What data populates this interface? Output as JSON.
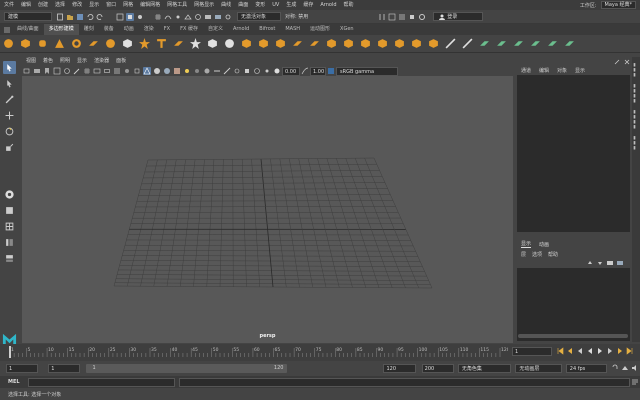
{
  "menubar": {
    "items": [
      "文件",
      "编辑",
      "创建",
      "选择",
      "修改",
      "显示",
      "窗口",
      "网格",
      "编辑网格",
      "网格工具",
      "网格显示",
      "曲线",
      "曲面",
      "变形",
      "UV",
      "生成",
      "缓存",
      "Arnold",
      "帮助"
    ],
    "workspace_label": "工作区:",
    "workspace_value": "Maya 经典*"
  },
  "statusline": {
    "menuset": "建模",
    "name_field_placeholder": "无激活对象",
    "symmetry_label": "对称: 禁用",
    "login": "登录"
  },
  "shelf": {
    "tabs": [
      "曲线/曲面",
      "多边形建模",
      "雕刻",
      "装备",
      "动画",
      "渲染",
      "FX",
      "FX 缓存",
      "自定义",
      "Arnold",
      "Bifrost",
      "MASH",
      "运动图形",
      "XGen"
    ],
    "active_tab": "多边形建模",
    "colors": {
      "orange": "#e39a2b",
      "green": "#6bbf8e",
      "white": "#e0e0e0"
    }
  },
  "panel": {
    "menu": [
      "视图",
      "着色",
      "照明",
      "显示",
      "渲染器",
      "面板"
    ],
    "exposure": "0.00",
    "gamma": "1.00",
    "colorspace": "sRGB gamma",
    "camera_label": "persp"
  },
  "outliner": {
    "menu": [
      "通道",
      "编辑",
      "对象",
      "显示"
    ]
  },
  "layer_editor": {
    "tabs": [
      "显示",
      "动画"
    ],
    "menu": [
      "层",
      "选项",
      "帮助"
    ]
  },
  "time_slider": {
    "ticks": [
      "1",
      "5",
      "10",
      "15",
      "20",
      "25",
      "30",
      "35",
      "40",
      "45",
      "50",
      "55",
      "60",
      "65",
      "70",
      "75",
      "80",
      "85",
      "90",
      "95",
      "100",
      "105",
      "110",
      "115",
      "120"
    ],
    "current_frame": "1"
  },
  "range_slider": {
    "start": "1",
    "anim_start": "1",
    "range_start_label": "1",
    "range_end_label": "120",
    "range_end": "120",
    "anim_end": "200",
    "character_set": "无角色集",
    "anim_layer": "无动画层",
    "fps": "24 fps"
  },
  "command_line": {
    "label": "MEL"
  },
  "help_line": {
    "text": "选择工具: 选择一个对象"
  }
}
